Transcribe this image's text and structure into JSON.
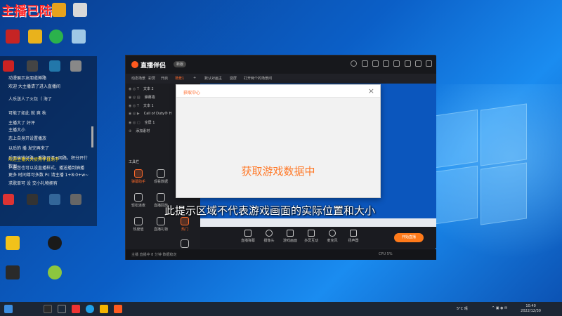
{
  "desktop": {
    "title": "主播已陆亡"
  },
  "chat": {
    "lines": [
      "动漫展示友朋道摊路",
      "欢迎 大主播请了进入直播间",
      "人乐送人了火包（ 海了",
      "可能了如此 就 爽 秋",
      "主播大了 好评",
      "主播大小",
      "恋上自身开设置播放",
      "以后的 播 发完再来了",
      "后面搞钱好路，看路开清+网路，积分开什",
      "数图",
      "欢迎主播大大使用伴直助手",
      "：送您也可以设直播样式，播送播到抽播",
      "更多 时间尊可多数 Pc 请主播 1+8:0+w~",
      "求歌单可 设 交小礼物拥有"
    ]
  },
  "app": {
    "brand": "直播伴侣",
    "version": "新版",
    "tabs": [
      "动态场景",
      "彩屏",
      "开启",
      "场景1",
      "+",
      "默认对画主",
      "竖屏",
      "打开两个的场景间"
    ],
    "scenes": [
      "文本 2",
      "弹幕墙",
      "文本 1",
      "Call of Duty® H",
      "全屏 1"
    ],
    "add_source": "添加素材",
    "tools_title": "工具栏",
    "tools": [
      "弹幕助手",
      "观看数据",
      "轻松连麦",
      "直播回放",
      "热度值",
      "直播礼物",
      "热门",
      "礼物"
    ],
    "bottom_tools": [
      "直播弹幕",
      "摄像头",
      "游戏画面",
      "多屏互动",
      "麦克风",
      "扬声器"
    ],
    "start_label": "开始直播",
    "status": "主播 直播中 8 分钟 数据稳定",
    "stats": "CPU  5%"
  },
  "modal": {
    "title": "获取中心",
    "close": "×",
    "message": "获取游戏数据中"
  },
  "caption": "此提示区域不代表游戏画面的实际位置和大小",
  "taskbar": {
    "weather": "5°C 晴",
    "time": "10:40",
    "date": "2022/12/30"
  }
}
